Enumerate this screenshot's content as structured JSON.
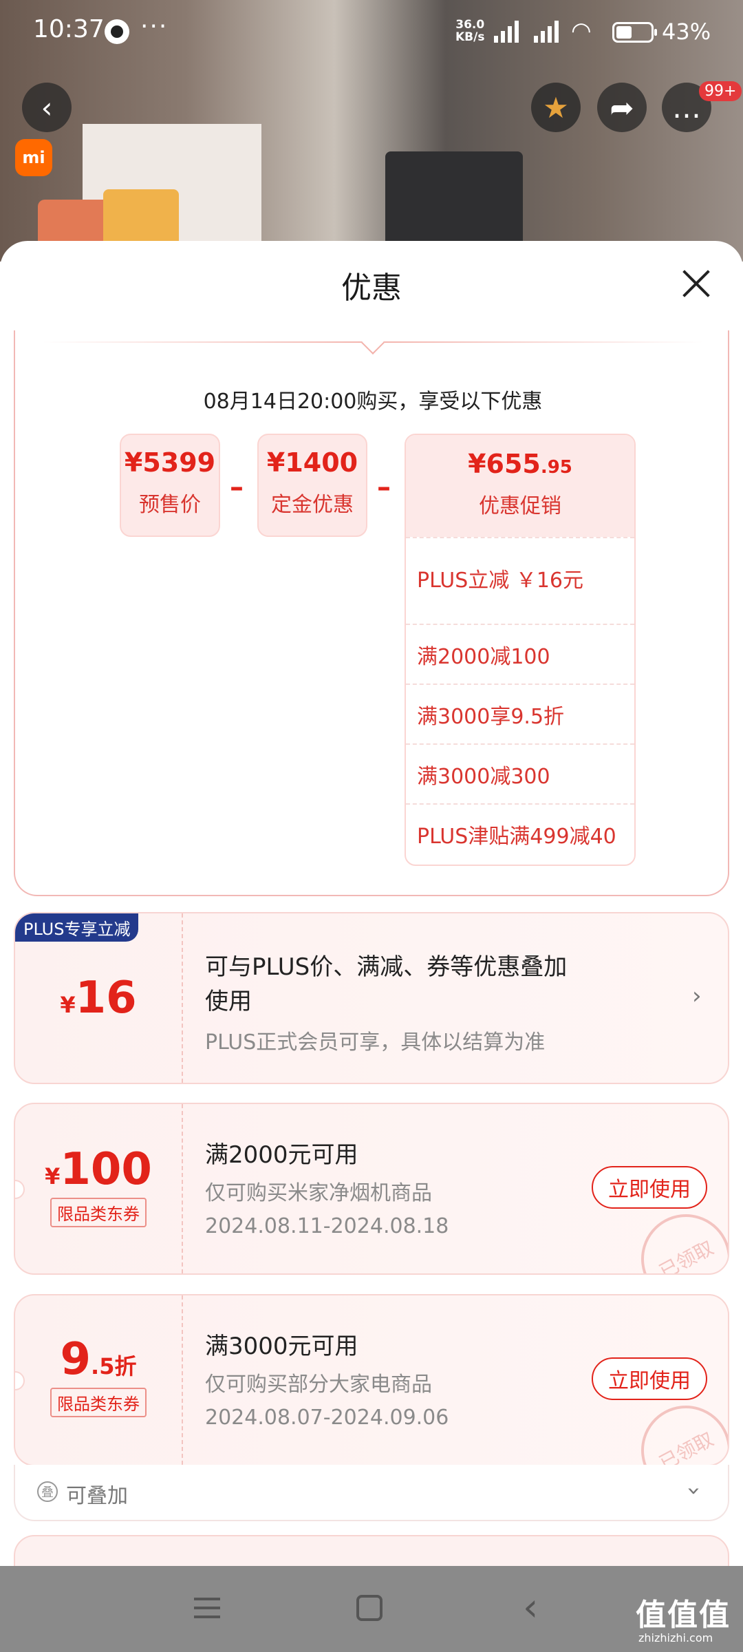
{
  "status_bar": {
    "time": "10:37",
    "more": "···",
    "net_speed_top": "36.0",
    "net_speed_unit": "KB/s",
    "battery_pct": "43%",
    "battery_level": 0.43
  },
  "top_nav": {
    "badge": "99+",
    "brand_logo": "mi"
  },
  "sheet": {
    "title": "优惠",
    "summary": {
      "headline": "08月14日20:00购买，享受以下优惠",
      "presale": {
        "amount": "¥5399",
        "label": "预售价"
      },
      "deposit": {
        "amount": "¥1400",
        "label": "定金优惠"
      },
      "promo": {
        "amount_main": "¥655",
        "amount_dec": ".95",
        "label": "优惠促销",
        "items": [
          "PLUS立减 ￥16元",
          "满2000减100",
          "满3000享9.5折",
          "满3000减300",
          "PLUS津贴满499减40"
        ]
      },
      "minus": "–"
    },
    "plus_card": {
      "badge": "PLUS专享立减",
      "currency": "¥",
      "amount": "16",
      "title_line1": "可与PLUS价、满减、券等优惠叠加",
      "title_line2": "使用",
      "subtitle": "PLUS正式会员可享，具体以结算为准"
    },
    "coupons": [
      {
        "currency": "¥",
        "amount": "100",
        "tag": "限品类东券",
        "title": "满2000元可用",
        "desc": "仅可购买米家净烟机商品",
        "dates": "2024.08.11-2024.08.18",
        "button": "立即使用",
        "stamp": "已领取"
      },
      {
        "amount": "9",
        "amount_dec": ".5折",
        "tag": "限品类东券",
        "title": "满3000元可用",
        "desc": "仅可购买部分大家电商品",
        "dates": "2024.08.07-2024.09.06",
        "button": "立即使用",
        "stamp": "已领取"
      }
    ],
    "stackable": {
      "icon_glyph": "叠",
      "label": "可叠加"
    }
  },
  "watermark": {
    "main": "值值值",
    "sub": "zhizhizhi.com"
  },
  "icons": {
    "back": "chevron-left-icon",
    "favorite": "star-icon",
    "share": "share-icon",
    "more": "more-icon",
    "close": "close-icon"
  },
  "colors": {
    "accent": "#e2231a",
    "plus_badge": "#233a8c",
    "card_bg": "#fdf1f0"
  }
}
